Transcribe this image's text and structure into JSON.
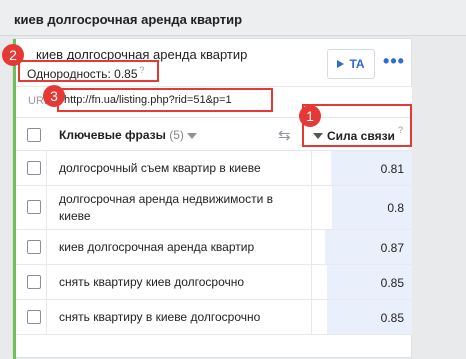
{
  "page": {
    "title": "киев долгосрочная аренда квартир"
  },
  "card": {
    "title": "киев долгосрочная аренда квартир",
    "homogeneity_label": "Однородность: 0.85",
    "homogeneity_hint": "?",
    "ta_button": "TA",
    "more_button": "•••",
    "url_label": "URL",
    "url_value": "http://fn.ua/listing.php?rid=51&p=1"
  },
  "table": {
    "phrase_header": "Ключевые фразы",
    "phrase_count": "(5)",
    "strength_header": "Сила связи",
    "strength_hint": "?",
    "rows": [
      {
        "phrase": "долгосрочный съем квартир в киеве",
        "value": "0.81",
        "fill": 0.81
      },
      {
        "phrase": "долгосрочная аренда недвижимости в киеве",
        "value": "0.8",
        "fill": 0.8
      },
      {
        "phrase": "киев долгосрочная аренда квартир",
        "value": "0.87",
        "fill": 0.87
      },
      {
        "phrase": "снять квартиру киев долгосрочно",
        "value": "0.85",
        "fill": 0.85
      },
      {
        "phrase": "снять квартиру в киеве долгосрочно",
        "value": "0.85",
        "fill": 0.85
      }
    ]
  },
  "annotations": [
    {
      "number": "1"
    },
    {
      "number": "2"
    },
    {
      "number": "3"
    }
  ],
  "colors": {
    "accent": "#2f6bd8",
    "annotation": "#e53935",
    "status_bar": "#6ac259",
    "value_fill": "#e9effb"
  }
}
